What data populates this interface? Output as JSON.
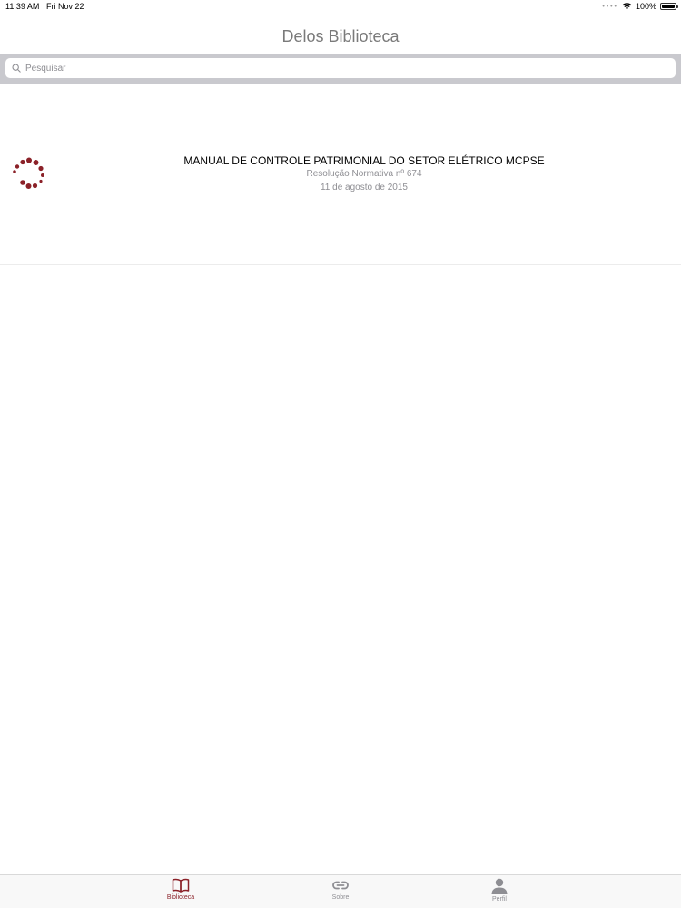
{
  "status_bar": {
    "time": "11:39 AM",
    "date": "Fri Nov 22",
    "battery": "100%"
  },
  "nav": {
    "title": "Delos Biblioteca"
  },
  "search": {
    "placeholder": "Pesquisar"
  },
  "library": {
    "items": [
      {
        "title": "MANUAL DE CONTROLE PATRIMONIAL DO SETOR ELÉTRICO MCPSE",
        "subtitle": "Resolução Normativa nº 674",
        "date": "11 de agosto de 2015"
      }
    ]
  },
  "tab_bar": {
    "tabs": [
      {
        "label": "Biblioteca",
        "icon": "book-icon",
        "active": true
      },
      {
        "label": "Sobre",
        "icon": "link-icon",
        "active": false
      },
      {
        "label": "Perfil",
        "icon": "person-icon",
        "active": false
      }
    ]
  },
  "colors": {
    "accent": "#8b2128",
    "inactive": "#8e8e93",
    "search_bg": "#c9c9ce"
  }
}
